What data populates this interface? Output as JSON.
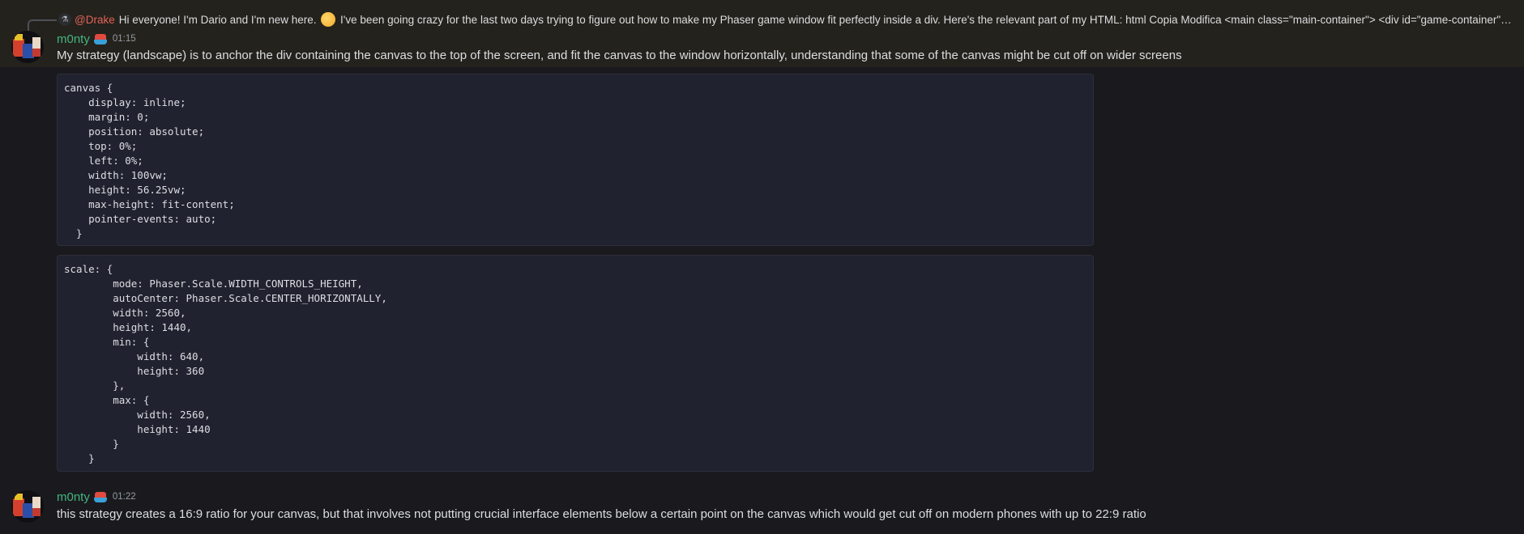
{
  "reply": {
    "mention": "@Drake",
    "text_before_emoji": "Hi everyone! I'm Dario and I'm new here.",
    "text_after_emoji": "I've been going crazy for the last two days trying to figure out how to make my Phaser game window fit perfectly inside a div. Here's the relevant part of my HTML:  html Copia Modifica <main class=\"main-container\">  <div id=\"game-container\"></di..."
  },
  "messages": [
    {
      "username": "m0nty",
      "timestamp": "01:15",
      "text": "My strategy (landscape) is to anchor the div containing the canvas to the top of the screen, and fit the canvas to the window horizontally, understanding that some of the canvas might be cut off on wider screens",
      "code_blocks": [
        "canvas {\n    display: inline;\n    margin: 0;\n    position: absolute;\n    top: 0%;\n    left: 0%;\n    width: 100vw;\n    height: 56.25vw;\n    max-height: fit-content;\n    pointer-events: auto;\n  }",
        "scale: {\n        mode: Phaser.Scale.WIDTH_CONTROLS_HEIGHT,\n        autoCenter: Phaser.Scale.CENTER_HORIZONTALLY,\n        width: 2560,\n        height: 1440,\n        min: {\n            width: 640,\n            height: 360\n        },\n        max: {\n            width: 2560,\n            height: 1440\n        }\n    }"
      ]
    },
    {
      "username": "m0nty",
      "timestamp": "01:22",
      "text": "this strategy creates a 16:9 ratio for your canvas, but that involves not putting crucial interface elements below a certain point on the canvas which would get cut off on modern phones with up to 22:9 ratio"
    }
  ],
  "colors": {
    "background": "#1a1a1e",
    "username": "#43b581",
    "mention": "#e0625a",
    "code_background": "#21222f"
  },
  "icons": {
    "emoji": "grinning-sweat-emoji",
    "badge": "boat-badge-icon"
  }
}
